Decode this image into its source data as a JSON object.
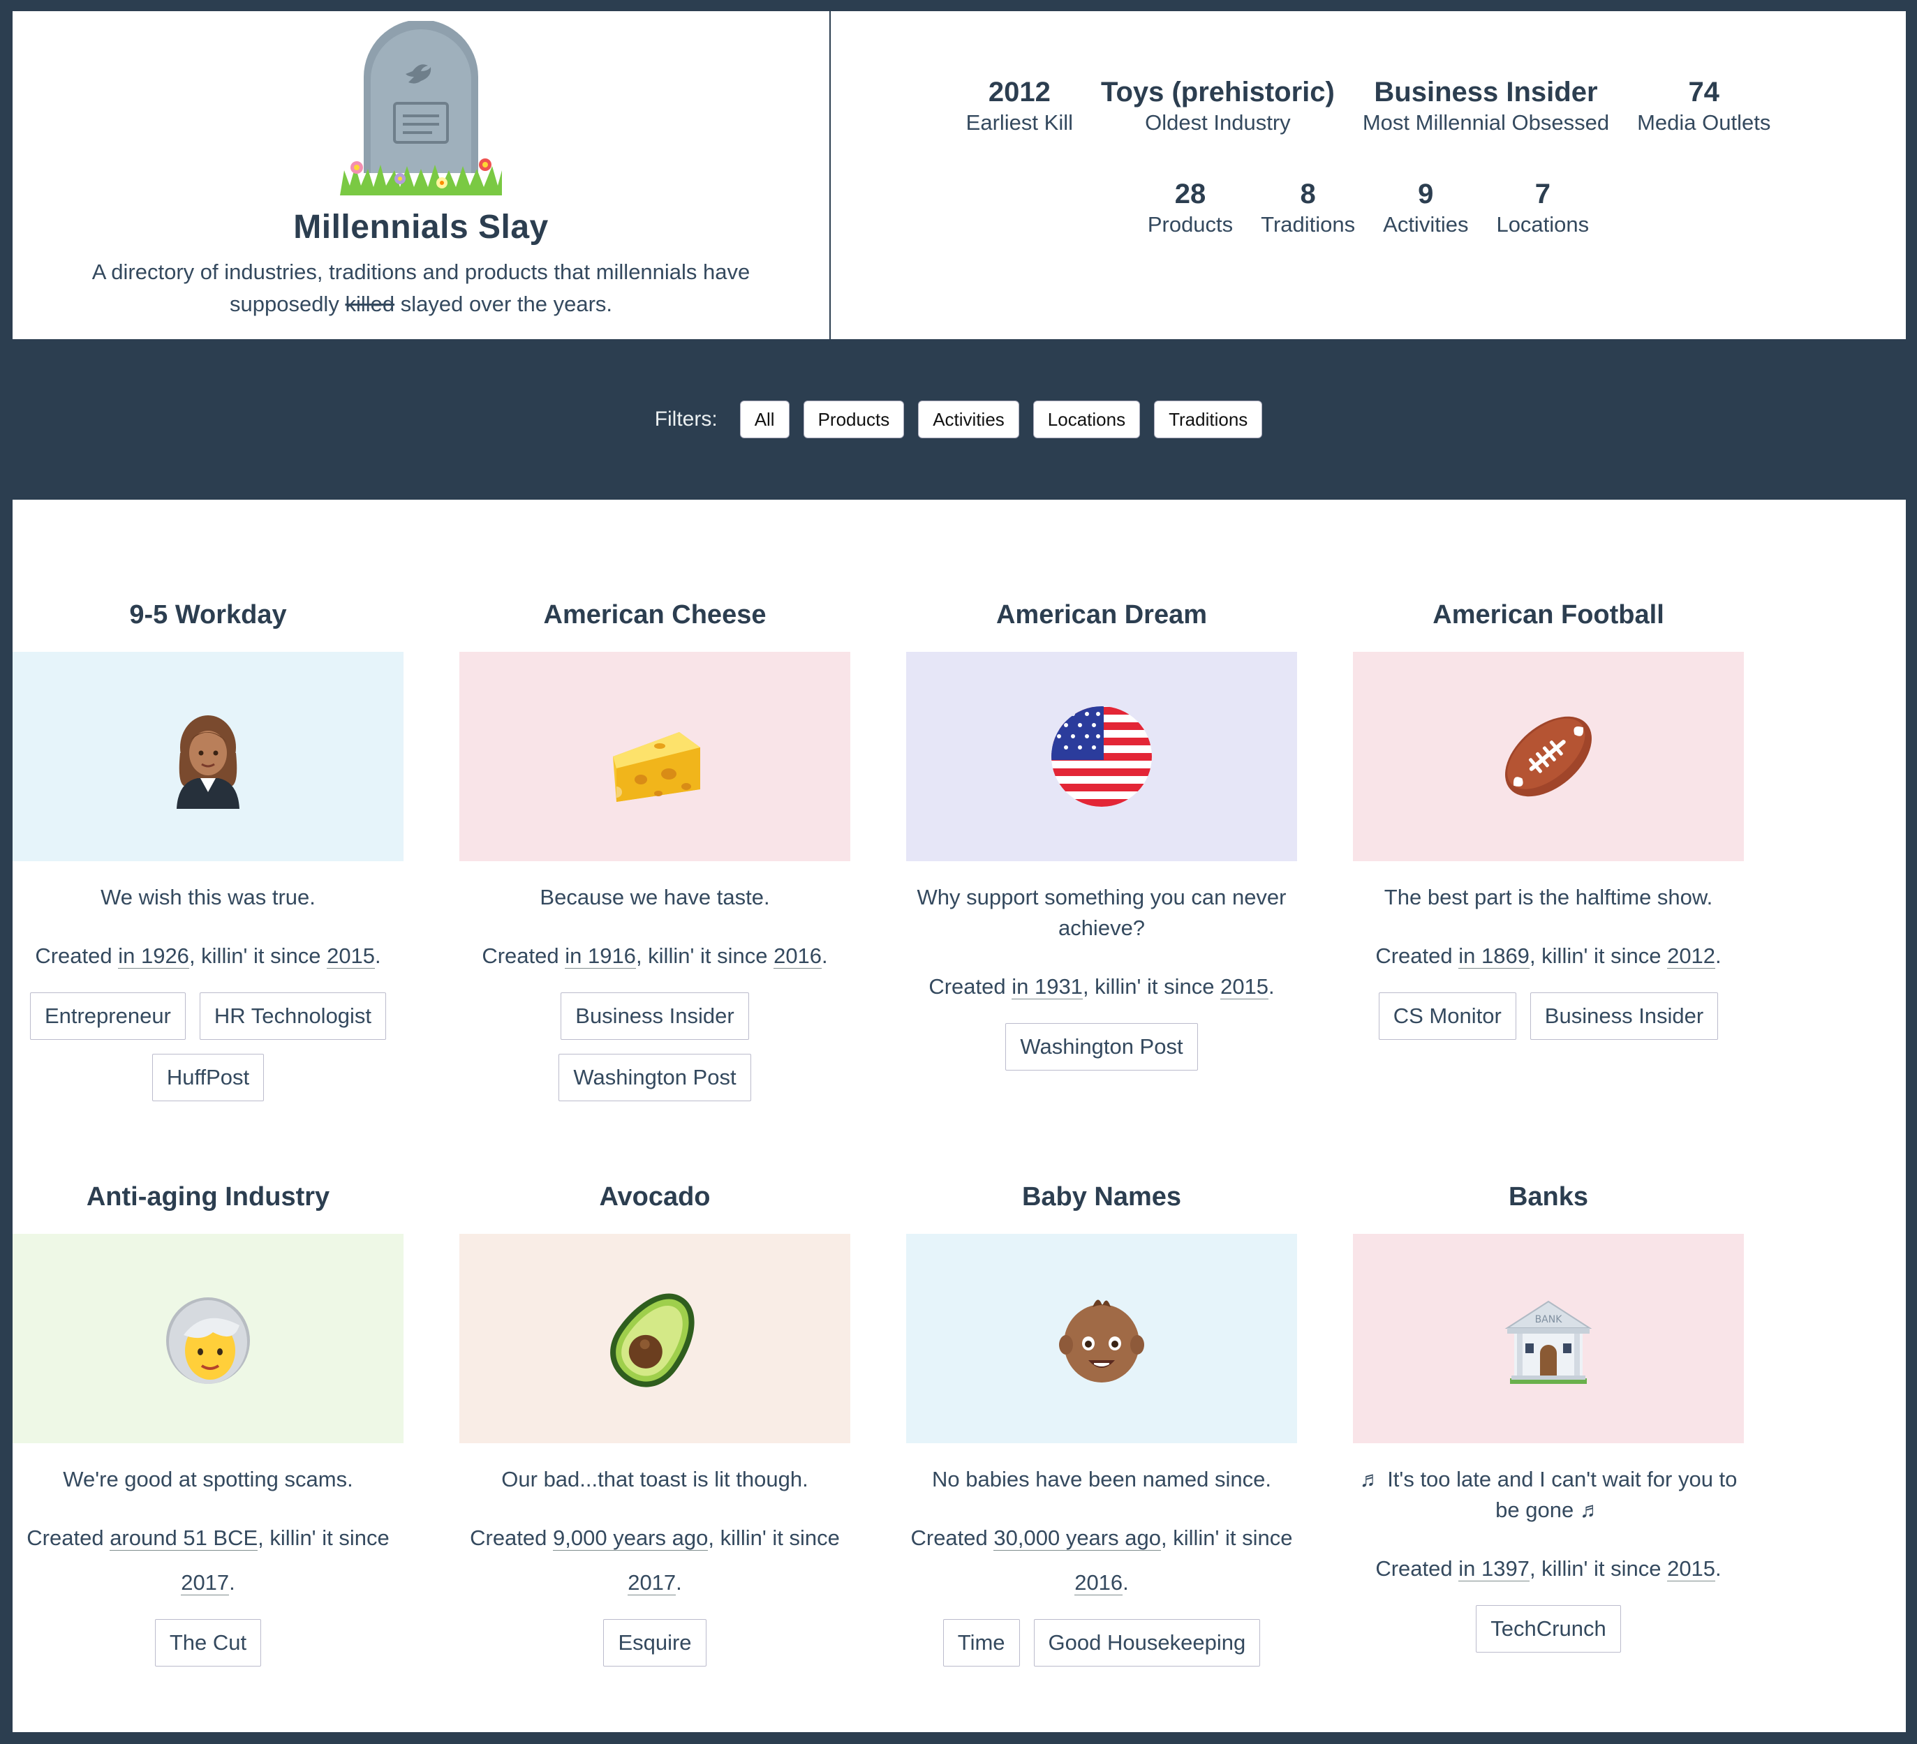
{
  "header": {
    "title": "Millennials Slay",
    "desc_prefix": "A directory of industries, traditions and products that millennials have supposedly",
    "desc_struck": "killed",
    "desc_suffix": "slayed over the years."
  },
  "stats": {
    "row1": [
      {
        "value": "2012",
        "label": "Earliest Kill"
      },
      {
        "value": "Toys (prehistoric)",
        "label": "Oldest Industry"
      },
      {
        "value": "Business Insider",
        "label": "Most Millennial Obsessed"
      },
      {
        "value": "74",
        "label": "Media Outlets"
      }
    ],
    "row2": [
      {
        "value": "28",
        "label": "Products"
      },
      {
        "value": "8",
        "label": "Traditions"
      },
      {
        "value": "9",
        "label": "Activities"
      },
      {
        "value": "7",
        "label": "Locations"
      }
    ]
  },
  "filters": {
    "label": "Filters:",
    "buttons": [
      "All",
      "Products",
      "Activities",
      "Locations",
      "Traditions"
    ]
  },
  "cards": [
    {
      "title": "9-5 Workday",
      "icon": "businesswoman-icon",
      "bg": "#e6f4fa",
      "desc": "We wish this was true.",
      "created_prefix": "Created ",
      "created_when": "in 1926",
      "created_mid": ", killin' it since ",
      "killed_year": "2015",
      "created_end": ".",
      "sources": [
        "Entrepreneur",
        "HR Technologist",
        "HuffPost"
      ]
    },
    {
      "title": "American Cheese",
      "icon": "cheese-icon",
      "bg": "#f9e4e8",
      "desc": "Because we have taste.",
      "created_prefix": "Created ",
      "created_when": "in 1916",
      "created_mid": ", killin' it since ",
      "killed_year": "2016",
      "created_end": ".",
      "sources": [
        "Business Insider",
        "Washington Post"
      ]
    },
    {
      "title": "American Dream",
      "icon": "us-flag-icon",
      "bg": "#e6e6f7",
      "desc": "Why support something you can never achieve?",
      "created_prefix": "Created ",
      "created_when": "in 1931",
      "created_mid": ", killin' it since ",
      "killed_year": "2015",
      "created_end": ".",
      "sources": [
        "Washington Post"
      ]
    },
    {
      "title": "American Football",
      "icon": "football-icon",
      "bg": "#f9e4e8",
      "desc": "The best part is the halftime show.",
      "created_prefix": "Created ",
      "created_when": "in 1869",
      "created_mid": ", killin' it since ",
      "killed_year": "2012",
      "created_end": ".",
      "sources": [
        "CS Monitor",
        "Business Insider"
      ]
    },
    {
      "title": "Anti-aging Industry",
      "icon": "older-woman-icon",
      "bg": "#eef8e6",
      "desc": "We're good at spotting scams.",
      "created_prefix": "Created ",
      "created_when": "around 51 BCE",
      "created_mid": ", killin' it since ",
      "killed_year": "2017",
      "created_end": ".",
      "sources": [
        "The Cut"
      ]
    },
    {
      "title": "Avocado",
      "icon": "avocado-icon",
      "bg": "#f9ede6",
      "desc": "Our bad...that toast is lit though.",
      "created_prefix": "Created ",
      "created_when": "9,000 years ago",
      "created_mid": ", killin' it since ",
      "killed_year": "2017",
      "created_end": ".",
      "sources": [
        "Esquire"
      ]
    },
    {
      "title": "Baby Names",
      "icon": "baby-icon",
      "bg": "#e6f4fa",
      "desc": "No babies have been named since.",
      "created_prefix": "Created ",
      "created_when": "30,000 years ago",
      "created_mid": ", killin' it since ",
      "killed_year": "2016",
      "created_end": ".",
      "sources": [
        "Time",
        "Good Housekeeping"
      ]
    },
    {
      "title": "Banks",
      "icon": "bank-icon",
      "bg": "#f9e4e8",
      "desc": "♬ It's too late and I can't wait for you to be gone ♬",
      "created_prefix": "Created ",
      "created_when": "in 1397",
      "created_mid": ", killin' it since ",
      "killed_year": "2015",
      "created_end": ".",
      "sources": [
        "TechCrunch"
      ]
    }
  ],
  "bank_sign": "BANK"
}
